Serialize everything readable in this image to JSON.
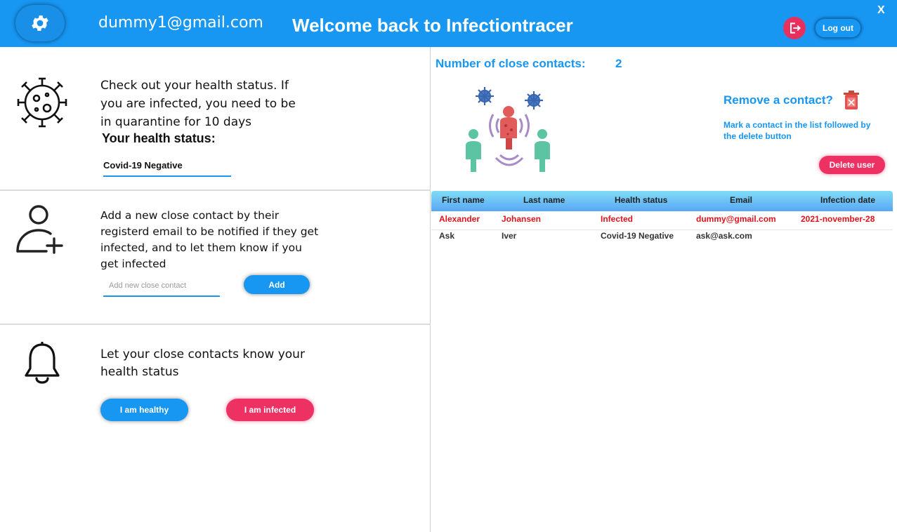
{
  "header": {
    "user_email": "dummy1@gmail.com",
    "title": "Welcome back to Infectiontracer",
    "close_label": "X",
    "logout_label": "Log out"
  },
  "health": {
    "description_lines": [
      "Check out your health status. If",
      "you are infected, you need to be",
      "in quarantine for 10 days"
    ],
    "heading": "Your health status:",
    "status_value": "Covid-19 Negative"
  },
  "add_contact": {
    "description_lines": [
      "Add a new close contact by their",
      "registerd email to be notified if they get",
      "infected, and to let them know if you",
      "get infected"
    ],
    "placeholder": "Add new close contact",
    "button_label": "Add"
  },
  "notify": {
    "description_lines": [
      "Let your close contacts know your",
      "health status"
    ],
    "healthy_label": "I am healthy",
    "infected_label": "I am infected"
  },
  "contacts": {
    "count_label": "Number of close contacts:",
    "count_value": "2",
    "remove_title": "Remove a contact?",
    "remove_hint": "Mark a contact in the list followed by the delete button",
    "delete_label": "Delete user"
  },
  "table": {
    "columns": [
      "First name",
      "Last name",
      "Health status",
      "Email",
      "Infection date"
    ],
    "rows": [
      {
        "first_name": "Alexander",
        "last_name": "Johansen",
        "health_status": "Infected",
        "email": "dummy@gmail.com",
        "infection_date": "2021-november-28",
        "infected": true
      },
      {
        "first_name": "Ask",
        "last_name": "Iver",
        "health_status": "Covid-19 Negative",
        "email": "ask@ask.com",
        "infection_date": "",
        "infected": false
      }
    ]
  },
  "colors": {
    "primary": "#1796f2",
    "danger": "#ee3163",
    "infected_text": "#e0131c"
  },
  "icons": [
    "gear-icon",
    "logout-icon",
    "virus-icon",
    "add-user-icon",
    "bell-icon",
    "trash-icon",
    "contact-tracing-illustration"
  ]
}
